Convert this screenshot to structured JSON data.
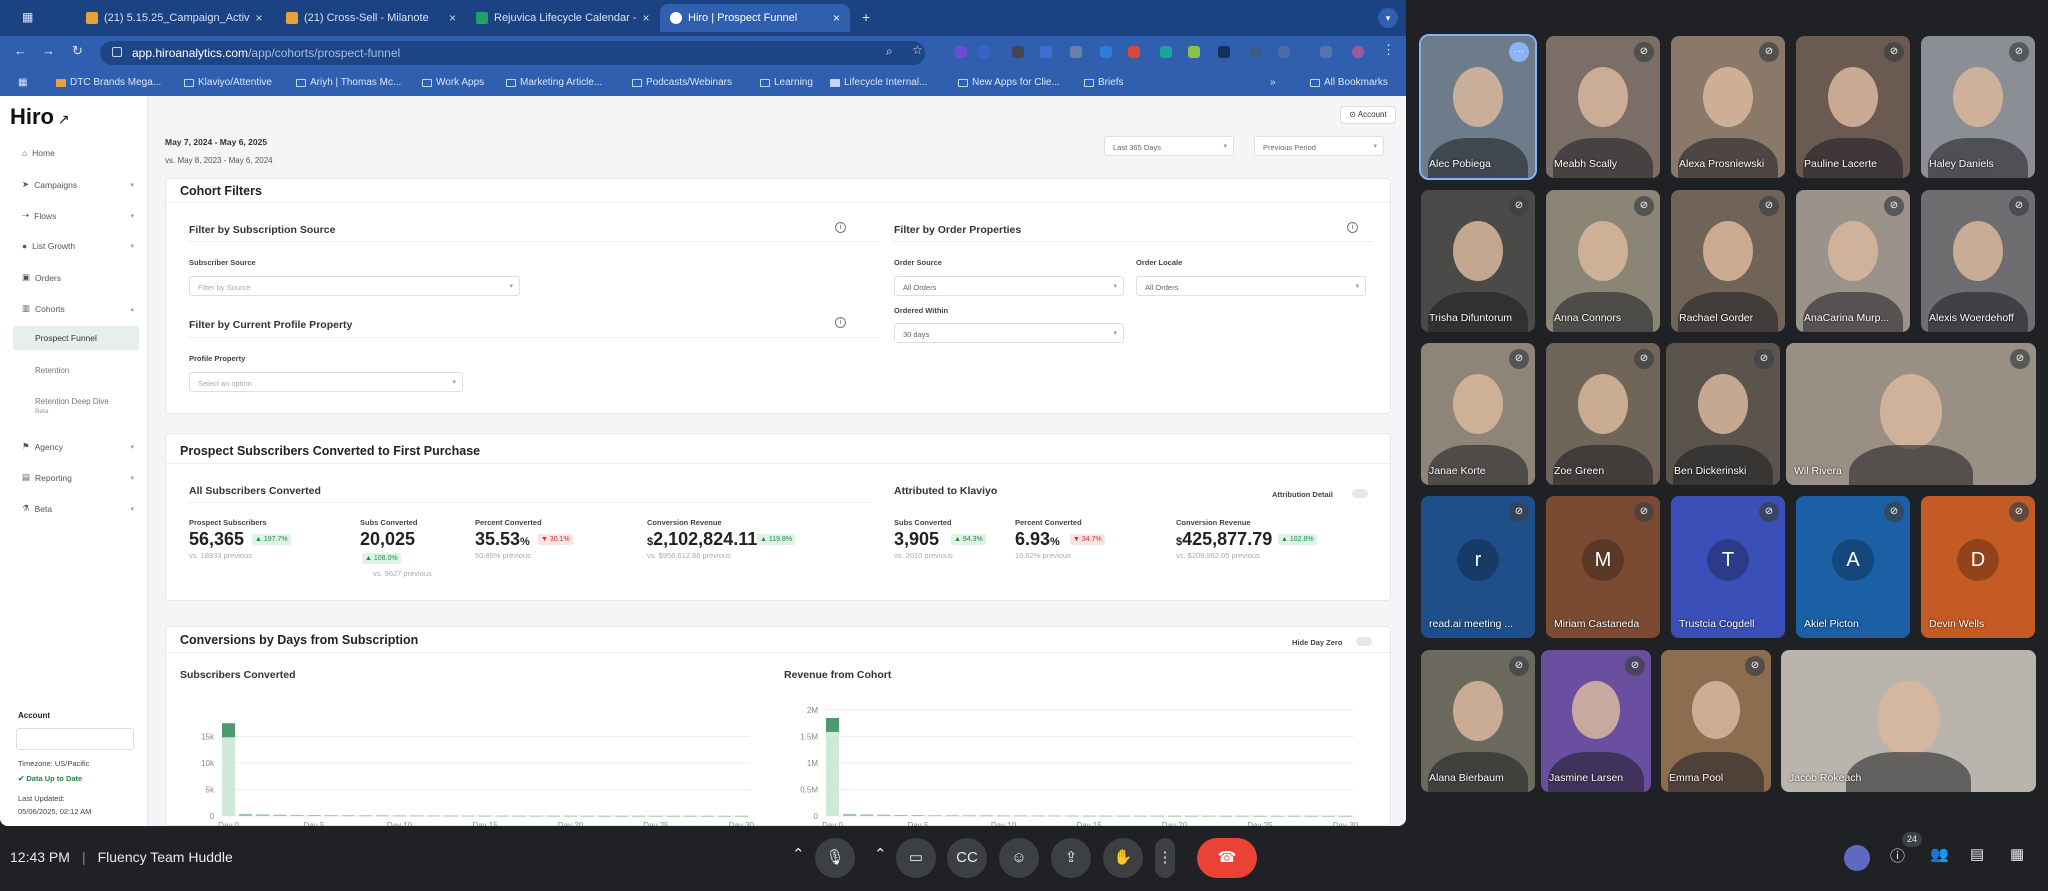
{
  "browser": {
    "tabs": [
      "(21) 5.15.25_Campaign_Activ",
      "(21) Cross-Sell - Milanote",
      "Rejuvica Lifecycle Calendar -",
      "Hiro | Prospect Funnel"
    ],
    "url_host": "app.hiroanalytics.com",
    "url_path": "/app/cohorts/prospect-funnel",
    "bookmarks": [
      "DTC Brands Mega...",
      "Klaviyo/Attentive",
      "Ariyh | Thomas Mc...",
      "Work Apps",
      "Marketing Article...",
      "Podcasts/Webinars",
      "Learning",
      "Lifecycle Internal...",
      "New Apps for Clie...",
      "Briefs"
    ],
    "all_bookmarks": "All Bookmarks"
  },
  "app": {
    "logo": "Hiro",
    "account_button": "Account",
    "date_range": "May 7, 2024 - May 6, 2025",
    "compare_range": "vs. May 8, 2023 - May 6, 2024",
    "period_select": "Last 365 Days",
    "compare_select": "Previous Period",
    "nav": {
      "home": "Home",
      "campaigns": "Campaigns",
      "flows": "Flows",
      "list_growth": "List Growth",
      "orders": "Orders",
      "cohorts": "Cohorts",
      "prospect_funnel": "Prospect Funnel",
      "retention": "Retention",
      "retention_deep_dive": "Retention Deep Dive",
      "beta_tag": "Beta",
      "agency": "Agency",
      "reporting": "Reporting",
      "beta": "Beta"
    },
    "sidebar_footer": {
      "account_label": "Account",
      "timezone": "Timezone: US/Pacific",
      "status": "Data Up to Date",
      "last_updated_label": "Last Updated:",
      "last_updated": "05/06/2025, 02:12 AM"
    },
    "filters": {
      "title": "Cohort Filters",
      "subscription_source": "Filter by Subscription Source",
      "subscriber_source_label": "Subscriber Source",
      "subscriber_source_placeholder": "Filter by Source",
      "profile_property_title": "Filter by Current Profile Property",
      "profile_property_label": "Profile Property",
      "profile_property_placeholder": "Select an option",
      "order_properties": "Filter by Order Properties",
      "order_source_label": "Order Source",
      "order_source_value": "All Orders",
      "order_locale_label": "Order Locale",
      "order_locale_value": "All Orders",
      "ordered_within_label": "Ordered Within",
      "ordered_within_value": "30 days"
    },
    "prospect": {
      "title": "Prospect Subscribers Converted to First Purchase",
      "all_title": "All Subscribers Converted",
      "attr_title": "Attributed to Klaviyo",
      "attr_detail": "Attribution Detail",
      "stats": [
        {
          "label": "Prospect Subscribers",
          "value": "56,365",
          "delta": "▲ 197.7%",
          "prev": "vs. 18933 previous"
        },
        {
          "label": "Subs Converted",
          "value": "20,025",
          "delta": "▲ 108.0%",
          "prev": "vs. 9627 previous"
        },
        {
          "label": "Percent Converted",
          "value": "35.53",
          "unit": "%",
          "delta": "▼ 30.1%",
          "prev": "50.85% previous"
        },
        {
          "label": "Conversion Revenue",
          "cur": "$",
          "value": "2,102,824.11",
          "delta": "▲ 119.8%",
          "prev": "vs. $956,612.66 previous"
        },
        {
          "label": "Subs Converted",
          "value": "3,905",
          "delta": "▲ 94.3%",
          "prev": "vs. 2010 previous"
        },
        {
          "label": "Percent Converted",
          "value": "6.93",
          "unit": "%",
          "delta": "▼ 34.7%",
          "prev": "10.62% previous"
        },
        {
          "label": "Conversion Revenue",
          "cur": "$",
          "value": "425,877.79",
          "delta": "▲ 102.8%",
          "prev": "vs. $209,992.05 previous"
        }
      ]
    },
    "conversions": {
      "title": "Conversions by Days from Subscription",
      "hide_day_zero": "Hide Day Zero",
      "left_chart_title": "Subscribers Converted",
      "right_chart_title": "Revenue from Cohort"
    }
  },
  "chart_data": [
    {
      "type": "bar",
      "title": "Subscribers Converted",
      "xticks": [
        "Day 0",
        "Day 5",
        "Day 10",
        "Day 15",
        "Day 20",
        "Day 25",
        "Day 30"
      ],
      "yticks": [
        "0",
        "5k",
        "10k",
        "15k"
      ],
      "ylim": [
        0,
        20000
      ],
      "x": [
        0,
        1,
        2,
        3,
        4,
        5,
        6,
        7,
        8,
        9,
        10,
        11,
        12,
        13,
        14,
        15,
        16,
        17,
        18,
        19,
        20,
        21,
        22,
        23,
        24,
        25,
        26,
        27,
        28,
        29,
        30
      ],
      "values": [
        17500,
        400,
        300,
        250,
        200,
        180,
        160,
        150,
        140,
        130,
        120,
        110,
        100,
        95,
        90,
        85,
        80,
        75,
        70,
        68,
        65,
        62,
        60,
        58,
        55,
        52,
        50,
        48,
        46,
        44,
        42
      ]
    },
    {
      "type": "bar",
      "title": "Revenue from Cohort",
      "xticks": [
        "Day 0",
        "Day 5",
        "Day 10",
        "Day 15",
        "Day 20",
        "Day 25",
        "Day 30"
      ],
      "yticks": [
        "0",
        "0.5M",
        "1M",
        "1.5M",
        "2M"
      ],
      "ylim": [
        0,
        2000000
      ],
      "x": [
        0,
        1,
        2,
        3,
        4,
        5,
        6,
        7,
        8,
        9,
        10,
        11,
        12,
        13,
        14,
        15,
        16,
        17,
        18,
        19,
        20,
        21,
        22,
        23,
        24,
        25,
        26,
        27,
        28,
        29,
        30
      ],
      "values": [
        1850000,
        40000,
        30000,
        25000,
        20000,
        18000,
        16000,
        15000,
        14000,
        13000,
        12000,
        11000,
        10000,
        9500,
        9000,
        8500,
        8000,
        7500,
        7000,
        6800,
        6500,
        6200,
        6000,
        5800,
        5500,
        5200,
        5000,
        4800,
        4600,
        4400,
        4200
      ]
    }
  ],
  "meet": {
    "participants": [
      "Alec Pobiega",
      "Meabh Scally",
      "Alexa Prosniewski",
      "Pauline Lacerte",
      "Haley Daniels",
      "Trisha Difuntorum",
      "Anna Connors",
      "Rachael Gorder",
      "AnaCarina Murp...",
      "Alexis Woerdehoff",
      "Janae Korte",
      "Zoe Green",
      "Ben Dickerinski",
      "Wil Rivera",
      "read.ai meeting ...",
      "Miriam Castaneda",
      "Trustcia Cogdell",
      "Akiel Picton",
      "Devin Wells",
      "Alana Bierbaum",
      "Jasmine Larsen",
      "Emma Pool",
      "Jacob Rokeach"
    ],
    "avatar_letters": [
      "r",
      "M",
      "T",
      "A",
      "D"
    ],
    "avatar_colors": [
      "#1f4f8a",
      "#7a4a33",
      "#3b4fb8",
      "#1b5fa5",
      "#c45a24"
    ],
    "time": "12:43 PM",
    "meeting_name": "Fluency Team Huddle",
    "people_count": "24"
  }
}
